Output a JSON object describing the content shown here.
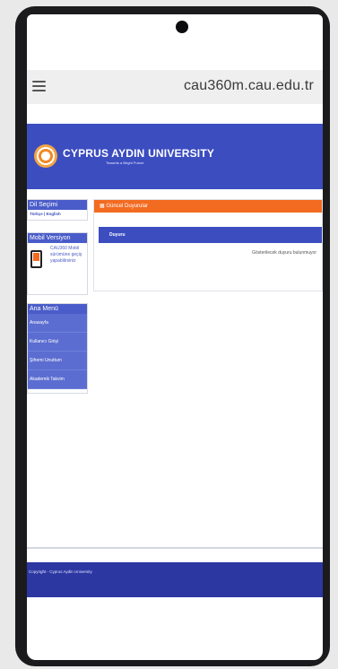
{
  "browser": {
    "url": "cau360m.cau.edu.tr"
  },
  "header": {
    "university_name": "CYPRUS AYDIN UNIVERSITY",
    "tagline": "Towards a Bright Future"
  },
  "sidebar": {
    "language_title": "Dil Seçimi",
    "language_links": "Türkçe | English",
    "mobile_title": "Mobil Versiyon",
    "mobile_text": "CAU360 Mobil sürümüne geçiş yapabilirsiniz",
    "menu_title": "Ana Menü",
    "menu_items": [
      {
        "label": "Anasayfa"
      },
      {
        "label": "Kullanıcı Girişi"
      },
      {
        "label": "Şifremi Unuttum"
      },
      {
        "label": "Akademik Takvim"
      }
    ]
  },
  "news": {
    "title": "Güncel Duyurular",
    "column_header": "Duyuru",
    "empty_message": "Gösterilecek duyuru bulunmuyor"
  },
  "footer": {
    "copyright": "Copyright - Cyprus Aydin University"
  },
  "colors": {
    "brand_blue": "#3c4dc0",
    "accent_orange": "#f26b21",
    "footer_blue": "#2c37a2"
  }
}
